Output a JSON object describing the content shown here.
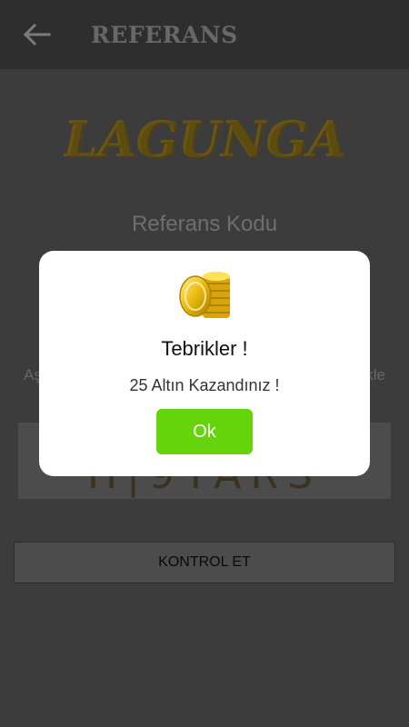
{
  "appbar": {
    "title": "REFERANS",
    "back_icon": "arrow-left-icon"
  },
  "main": {
    "logo_text": "LAGUNGA",
    "referral_label": "Referans Kodu",
    "instruction_start": "Aş",
    "instruction_end": "kle",
    "code_value": "H|9YARS",
    "check_button_label": "KONTROL ET"
  },
  "dialog": {
    "icon": "gold-coins-icon",
    "title": "Tebrikler !",
    "message": "25 Altın Kazandınız !",
    "ok_label": "Ok"
  },
  "colors": {
    "accent_green": "#66d40a",
    "appbar": "#545454",
    "coin_gold": "#e8b90c"
  }
}
